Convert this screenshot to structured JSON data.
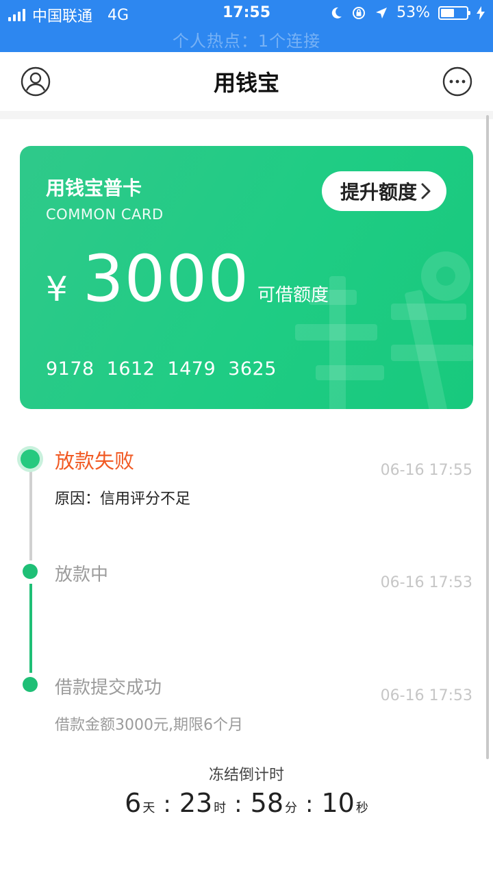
{
  "status_bar": {
    "carrier": "中国联通",
    "network": "4G",
    "time": "17:55",
    "battery": "53%",
    "battery_fraction": 0.53,
    "hotspot": "个人热点：1个连接"
  },
  "nav": {
    "title": "用钱宝",
    "left_icon": "user-icon",
    "right_icon": "more-icon"
  },
  "card": {
    "name": "用钱宝普卡",
    "subtitle": "COMMON CARD",
    "raise_button": "提升额度",
    "currency": "¥",
    "amount": "3000",
    "amount_label": "可借额度",
    "number_groups": [
      "9178",
      "1612",
      "1479",
      "3625"
    ],
    "color": "#22c983"
  },
  "timeline": [
    {
      "title": "放款失败",
      "time": "06-16 17:55",
      "note": "原因：信用评分不足",
      "status": "failed"
    },
    {
      "title": "放款中",
      "time": "06-16 17:53",
      "note": "",
      "status": "done"
    },
    {
      "title": "借款提交成功",
      "time": "06-16 17:53",
      "note": "借款金额3000元,期限6个月",
      "status": "done"
    }
  ],
  "countdown": {
    "label": "冻结倒计时",
    "days": "6",
    "days_unit": "天",
    "hours": "23",
    "hours_unit": "时",
    "minutes": "58",
    "minutes_unit": "分",
    "seconds": "10",
    "seconds_unit": "秒",
    "separator": ":"
  },
  "colors": {
    "status_bar": "#2d87f0",
    "accent_green": "#1fbf76",
    "fail_orange": "#f15a24"
  }
}
